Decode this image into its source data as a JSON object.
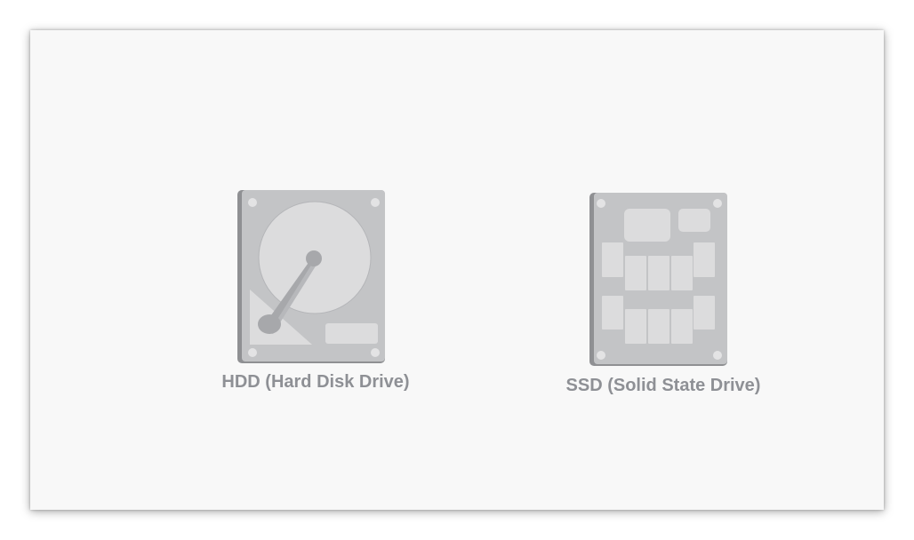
{
  "drives": {
    "hdd": {
      "label": "HDD (Hard Disk Drive)",
      "icon": "hard-disk-drive-icon"
    },
    "ssd": {
      "label": "SSD (Solid State Drive)",
      "icon": "solid-state-drive-icon"
    }
  },
  "colors": {
    "background": "#f8f8f8",
    "label": "#8e9095",
    "drive_body": "#c3c4c6",
    "drive_edge": "#8f9093",
    "drive_part": "#dcdcdd"
  }
}
